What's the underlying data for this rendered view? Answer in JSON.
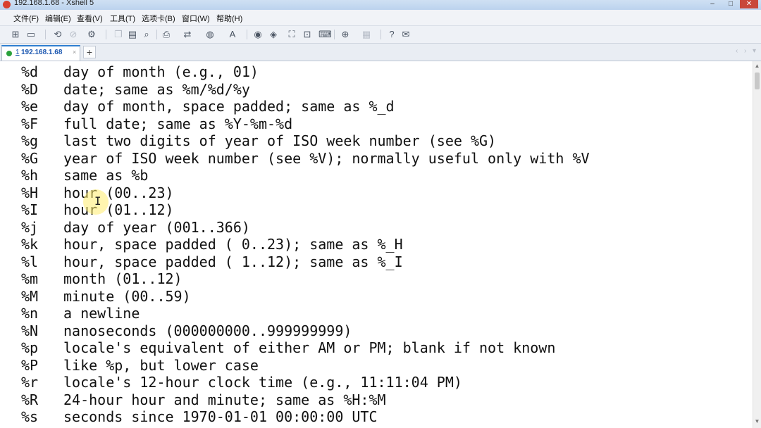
{
  "window": {
    "title": "192.168.1.68 - Xshell 5"
  },
  "menu": [
    "文件(F)",
    "编辑(E)",
    "查看(V)",
    "工具(T)",
    "选项卡(B)",
    "窗口(W)",
    "帮助(H)"
  ],
  "toolbar_icons": [
    "new-session-icon",
    "open-folder-icon",
    "reconnect-icon",
    "disconnect-icon",
    "properties-icon",
    "copy-icon",
    "paste-icon",
    "find-icon",
    "print-icon",
    "transfer-icon",
    "globe-icon",
    "font-icon",
    "xftp-icon",
    "xmanager-icon",
    "lock-icon",
    "fullscreen-icon",
    "keyboard-icon",
    "add-compose-icon",
    "layout-icon",
    "help-icon",
    "chat-icon"
  ],
  "tab": {
    "index": "1",
    "label": "192.168.1.68",
    "close": "×",
    "add": "+",
    "status_color": "#2aa13b"
  },
  "terminal": {
    "lines": [
      {
        "code": "%d",
        "desc": "day of month (e.g., 01)"
      },
      {
        "code": "%D",
        "desc": "date; same as %m/%d/%y"
      },
      {
        "code": "%e",
        "desc": "day of month, space padded; same as %_d"
      },
      {
        "code": "%F",
        "desc": "full date; same as %Y-%m-%d"
      },
      {
        "code": "%g",
        "desc": "last two digits of year of ISO week number (see %G)"
      },
      {
        "code": "%G",
        "desc": "year of ISO week number (see %V); normally useful only with %V"
      },
      {
        "code": "%h",
        "desc": "same as %b"
      },
      {
        "code": "%H",
        "desc": "hour (00..23)"
      },
      {
        "code": "%I",
        "desc": "hour (01..12)"
      },
      {
        "code": "%j",
        "desc": "day of year (001..366)"
      },
      {
        "code": "%k",
        "desc": "hour, space padded ( 0..23); same as %_H"
      },
      {
        "code": "%l",
        "desc": "hour, space padded ( 1..12); same as %_I"
      },
      {
        "code": "%m",
        "desc": "month (01..12)"
      },
      {
        "code": "%M",
        "desc": "minute (00..59)"
      },
      {
        "code": "%n",
        "desc": "a newline"
      },
      {
        "code": "%N",
        "desc": "nanoseconds (000000000..999999999)"
      },
      {
        "code": "%p",
        "desc": "locale's equivalent of either AM or PM; blank if not known"
      },
      {
        "code": "%P",
        "desc": "like %p, but lower case"
      },
      {
        "code": "%r",
        "desc": "locale's 12-hour clock time (e.g., 11:11:04 PM)"
      },
      {
        "code": "%R",
        "desc": "24-hour hour and minute; same as %H:%M"
      },
      {
        "code": "%s",
        "desc": "seconds since 1970-01-01 00:00:00 UTC"
      }
    ]
  }
}
